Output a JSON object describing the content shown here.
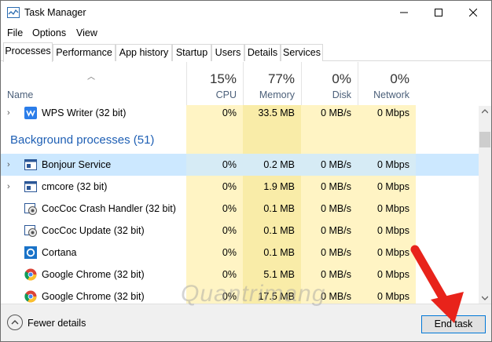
{
  "window": {
    "title": "Task Manager"
  },
  "menu": [
    "File",
    "Options",
    "View"
  ],
  "tabs": [
    "Processes",
    "Performance",
    "App history",
    "Startup",
    "Users",
    "Details",
    "Services"
  ],
  "columns": {
    "name": "Name",
    "cpu": {
      "pct": "15%",
      "label": "CPU"
    },
    "memory": {
      "pct": "77%",
      "label": "Memory"
    },
    "disk": {
      "pct": "0%",
      "label": "Disk"
    },
    "network": {
      "pct": "0%",
      "label": "Network"
    }
  },
  "apps_tail": {
    "name": "WPS Writer (32 bit)",
    "cpu": "0%",
    "memory": "33.5 MB",
    "disk": "0 MB/s",
    "network": "0 Mbps"
  },
  "section_title": "Background processes (51)",
  "processes": [
    {
      "name": "Bonjour Service",
      "cpu": "0%",
      "memory": "0.2 MB",
      "disk": "0 MB/s",
      "network": "0 Mbps"
    },
    {
      "name": "cmcore (32 bit)",
      "cpu": "0%",
      "memory": "1.9 MB",
      "disk": "0 MB/s",
      "network": "0 Mbps"
    },
    {
      "name": "CocCoc Crash Handler (32 bit)",
      "cpu": "0%",
      "memory": "0.1 MB",
      "disk": "0 MB/s",
      "network": "0 Mbps"
    },
    {
      "name": "CocCoc Update (32 bit)",
      "cpu": "0%",
      "memory": "0.1 MB",
      "disk": "0 MB/s",
      "network": "0 Mbps"
    },
    {
      "name": "Cortana",
      "cpu": "0%",
      "memory": "0.1 MB",
      "disk": "0 MB/s",
      "network": "0 Mbps"
    },
    {
      "name": "Google Chrome (32 bit)",
      "cpu": "0%",
      "memory": "5.1 MB",
      "disk": "0 MB/s",
      "network": "0 Mbps"
    },
    {
      "name": "Google Chrome (32 bit)",
      "cpu": "0%",
      "memory": "17.5 MB",
      "disk": "0 MB/s",
      "network": "0 Mbps"
    }
  ],
  "footer": {
    "fewer_details": "Fewer details",
    "end_task": "End task"
  },
  "watermark": "Quantrimang",
  "colors": {
    "cpu_heat": "#fff4c4",
    "memory_heat": "#f9eca8",
    "selection": "#cce8ff",
    "section": "#1e5fb4",
    "arrow": "#e8231b"
  }
}
